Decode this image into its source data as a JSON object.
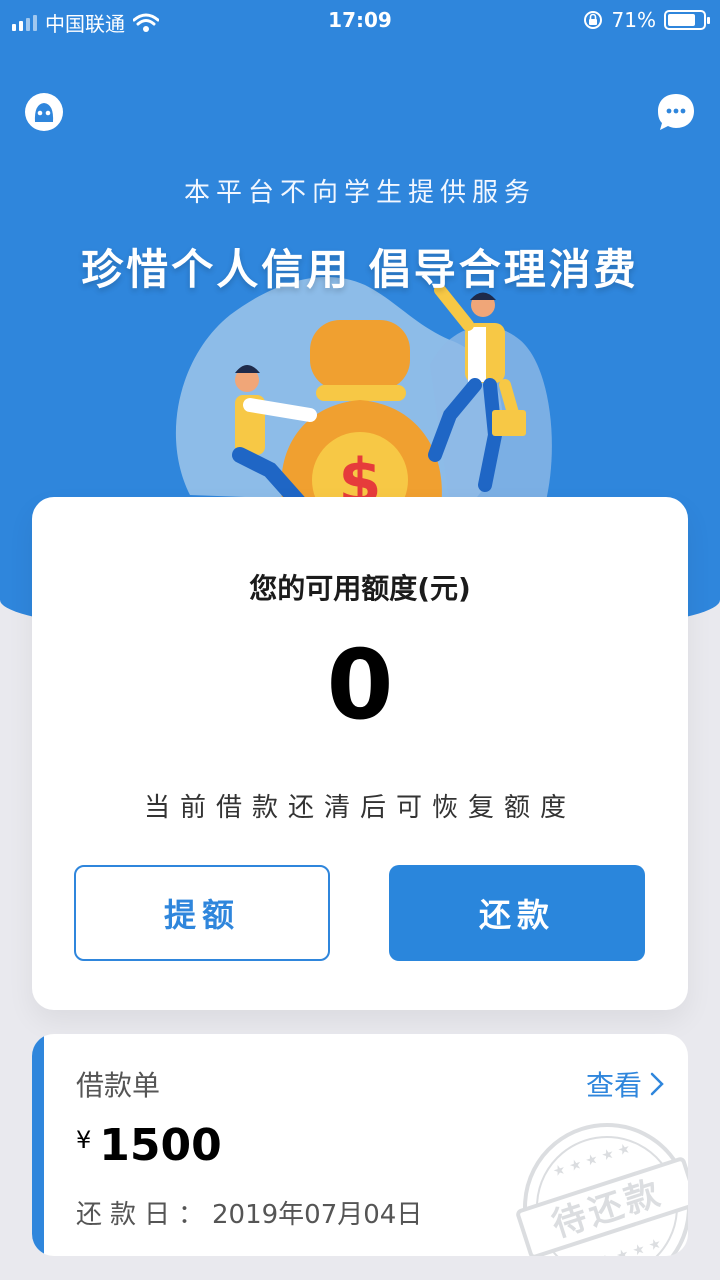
{
  "status_bar": {
    "carrier": "中国联通",
    "time": "17:09",
    "battery": "71%"
  },
  "header": {
    "subtitle": "本平台不向学生提供服务",
    "headline": "珍惜个人信用 倡导合理消费"
  },
  "credit_card": {
    "label": "您的可用额度(元)",
    "amount": "0",
    "hint": "当前借款还清后可恢复额度",
    "raise_button": "提额",
    "repay_button": "还款"
  },
  "loan": {
    "title": "借款单",
    "view_label": "查看",
    "currency": "¥",
    "amount": "1500",
    "due_label": "还款日：",
    "due_date": "2019年07月04日",
    "stamp_text": "待还款"
  },
  "colors": {
    "primary": "#2f86dc",
    "background": "#e9e9ee"
  }
}
